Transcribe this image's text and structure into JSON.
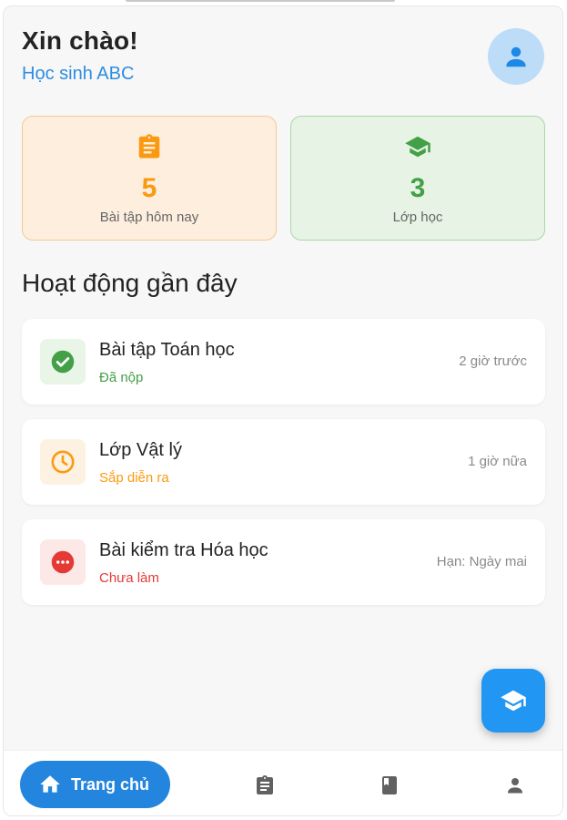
{
  "header": {
    "greeting": "Xin chào!",
    "user_name": "Học sinh ABC"
  },
  "stats": [
    {
      "value": "5",
      "label": "Bài tập hôm nay",
      "icon": "clipboard-icon",
      "color": "#fb9a10"
    },
    {
      "value": "3",
      "label": "Lớp học",
      "icon": "graduation-cap-icon",
      "color": "#43a047"
    }
  ],
  "section_title": "Hoạt động gần đây",
  "activities": [
    {
      "title": "Bài tập Toán học",
      "status": "Đã nộp",
      "time": "2 giờ trước",
      "icon": "check-circle-icon",
      "color": "#43a047"
    },
    {
      "title": "Lớp Vật lý",
      "status": "Sắp diễn ra",
      "time": "1 giờ nữa",
      "icon": "clock-icon",
      "color": "#fb9a10"
    },
    {
      "title": "Bài kiểm tra Hóa học",
      "status": "Chưa làm",
      "time": "Hạn: Ngày mai",
      "icon": "more-circle-icon",
      "color": "#e53935"
    }
  ],
  "bottom_nav": {
    "home_label": "Trang chủ",
    "items": [
      "home-icon",
      "clipboard-icon",
      "book-icon",
      "person-icon"
    ]
  },
  "colors": {
    "primary": "#2196f3",
    "nav_active": "#2385dd"
  }
}
